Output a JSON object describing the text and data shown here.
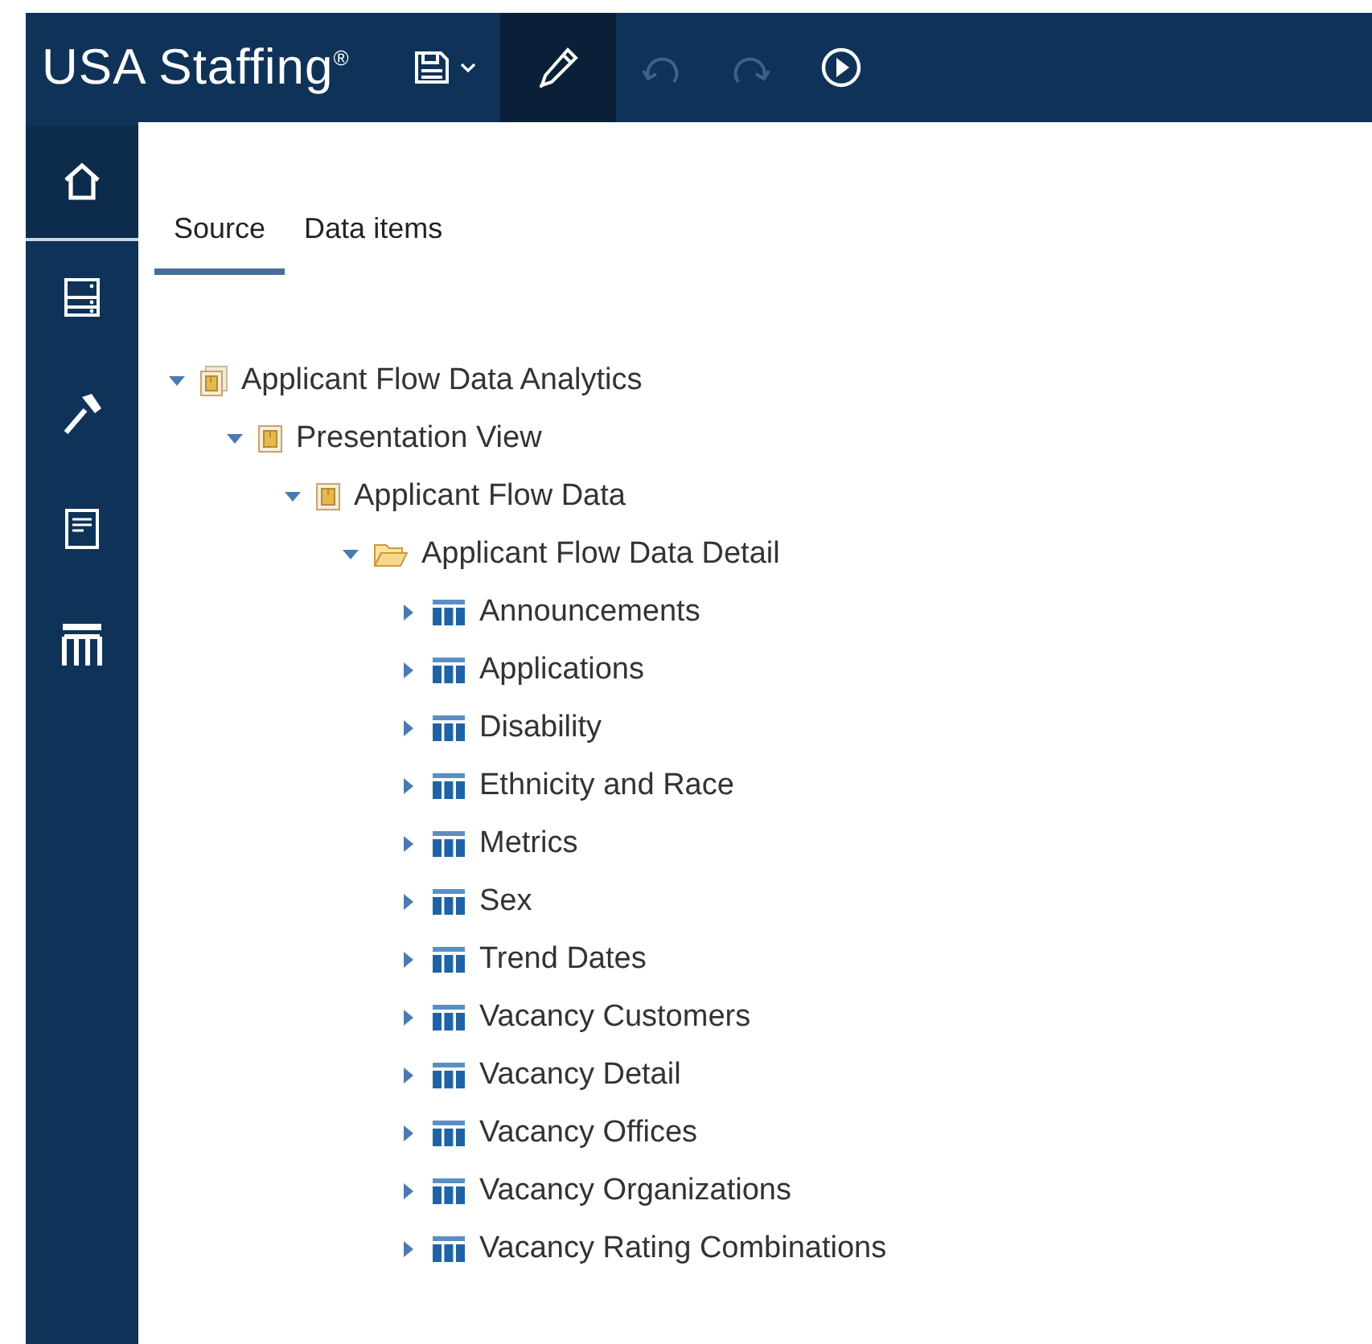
{
  "header": {
    "logo": "USA Staffing",
    "logo_mark": "®",
    "tools": [
      {
        "kind": "save",
        "disabled": false,
        "selected": false
      },
      {
        "kind": "edit",
        "disabled": false,
        "selected": true
      },
      {
        "kind": "undo",
        "disabled": true,
        "selected": false
      },
      {
        "kind": "redo",
        "disabled": true,
        "selected": false
      },
      {
        "kind": "run",
        "disabled": false,
        "selected": false
      }
    ]
  },
  "sidebar": {
    "items": [
      {
        "kind": "home",
        "selected": true
      },
      {
        "kind": "data",
        "selected": false
      },
      {
        "kind": "tools",
        "selected": false
      },
      {
        "kind": "page",
        "selected": false
      },
      {
        "kind": "table",
        "selected": false
      }
    ]
  },
  "tabs": [
    {
      "label": "Source",
      "selected": true
    },
    {
      "label": "Data items",
      "selected": false
    }
  ],
  "tree": [
    {
      "label": "Applicant Flow Data Analytics",
      "kind": "package",
      "expanded": true,
      "children": [
        {
          "label": "Presentation View",
          "kind": "namespace",
          "expanded": true,
          "children": [
            {
              "label": "Applicant Flow Data",
              "kind": "namespace",
              "expanded": true,
              "children": [
                {
                  "label": "Applicant Flow Data Detail",
                  "kind": "folder",
                  "expanded": true,
                  "children": [
                    {
                      "label": "Announcements",
                      "kind": "table",
                      "expanded": false
                    },
                    {
                      "label": "Applications",
                      "kind": "table",
                      "expanded": false
                    },
                    {
                      "label": "Disability",
                      "kind": "table",
                      "expanded": false
                    },
                    {
                      "label": "Ethnicity and Race",
                      "kind": "table",
                      "expanded": false
                    },
                    {
                      "label": "Metrics",
                      "kind": "table",
                      "expanded": false
                    },
                    {
                      "label": "Sex",
                      "kind": "table",
                      "expanded": false
                    },
                    {
                      "label": "Trend Dates",
                      "kind": "table",
                      "expanded": false
                    },
                    {
                      "label": "Vacancy Customers",
                      "kind": "table",
                      "expanded": false
                    },
                    {
                      "label": "Vacancy Detail",
                      "kind": "table",
                      "expanded": false
                    },
                    {
                      "label": "Vacancy Offices",
                      "kind": "table",
                      "expanded": false
                    },
                    {
                      "label": "Vacancy Organizations",
                      "kind": "table",
                      "expanded": false
                    },
                    {
                      "label": "Vacancy Rating Combinations",
                      "kind": "table",
                      "expanded": false
                    }
                  ]
                }
              ]
            }
          ]
        }
      ]
    }
  ]
}
